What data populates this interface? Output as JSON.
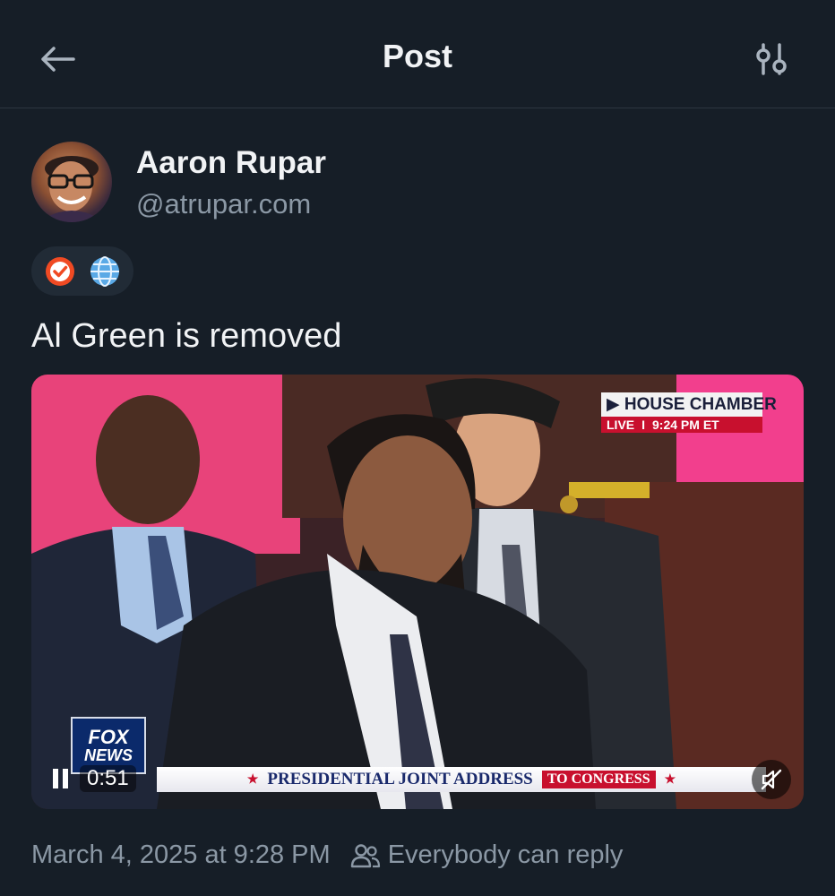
{
  "header": {
    "title": "Post",
    "back_icon": "arrow-left-icon",
    "filter_icon": "sliders-icon"
  },
  "author": {
    "name": "Aaron Rupar",
    "handle": "@atrupar.com"
  },
  "badges": [
    {
      "icon": "verified-check-icon",
      "color": "#f04a23"
    },
    {
      "icon": "globe-icon",
      "color": "#5aa9e6"
    }
  ],
  "post": {
    "text": "Al Green is removed"
  },
  "video": {
    "chamber_label": "HOUSE CHAMBER",
    "live_label": "LIVE",
    "live_separator": "I",
    "live_time": "9:24 PM ET",
    "network_line1": "FOX",
    "network_line2": "NEWS",
    "banner_main": "PRESIDENTIAL JOINT ADDRESS",
    "banner_sub": "TO CONGRESS",
    "banner_star": "★",
    "elapsed": "0:51",
    "state": "playing",
    "muted": true
  },
  "meta": {
    "timestamp": "March 4, 2025 at 9:28 PM",
    "reply_setting": "Everybody can reply"
  },
  "colors": {
    "background": "#161e27",
    "muted_text": "#8b98a5",
    "accent_red": "#c8102e"
  }
}
